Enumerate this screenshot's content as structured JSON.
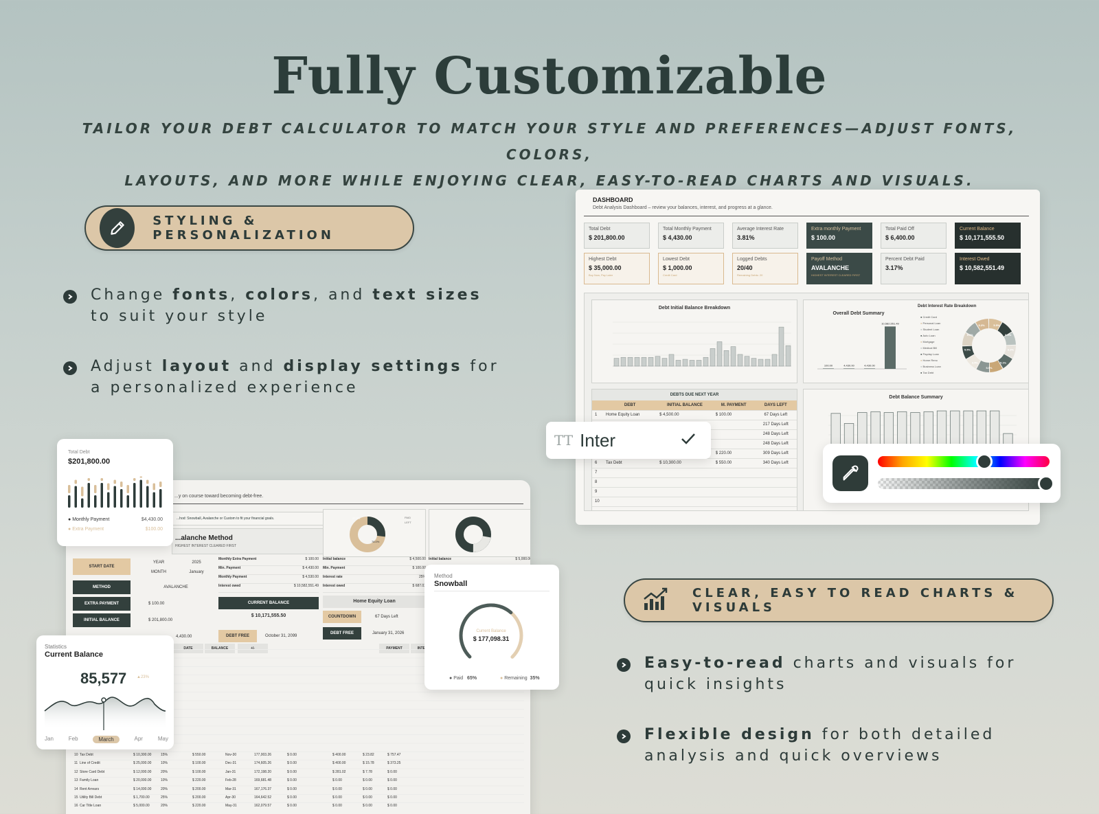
{
  "header": {
    "title": "Fully Customizable",
    "subtitle_line1": "TAILOR YOUR DEBT CALCULATOR TO MATCH YOUR STYLE AND PREFERENCES—ADJUST FONTS, COLORS,",
    "subtitle_line2": "LAYOUTS, AND MORE WHILE ENJOYING CLEAR, EASY-TO-READ CHARTS AND VISUALS."
  },
  "styling": {
    "pill_label": "STYLING & PERSONALIZATION",
    "icon": "pencil-icon",
    "bullets": [
      {
        "pre": "Change ",
        "b1": "fonts",
        "m1": ", ",
        "b2": "colors",
        "m2": ", and ",
        "b3": "text sizes",
        "post": " to suit your style"
      },
      {
        "pre": "Adjust ",
        "b1": "layout",
        "m1": " and ",
        "b2": "display settings",
        "post": " for a personalized experience"
      }
    ]
  },
  "charts_section": {
    "pill_label": "CLEAR, EASY TO READ CHARTS & VISUALS",
    "icon": "bar-chart-icon",
    "bullets": [
      {
        "b1": "Easy-to-read",
        "post": " charts and visuals for quick insights"
      },
      {
        "b1": "Flexible design",
        "post": " for both detailed analysis and quick overviews"
      }
    ]
  },
  "dashboard": {
    "title": "DASHBOARD",
    "subtitle": "Debt Analysis Dashboard – review your balances, interest, and progress at a glance.",
    "kpis_row1": [
      {
        "label": "Total Debt",
        "value": "$ 201,800.00"
      },
      {
        "label": "Total Monthly Payment",
        "value": "$ 4,430.00"
      },
      {
        "label": "Average Interest Rate",
        "value": "3.81%"
      },
      {
        "label": "Extra monthly Payment",
        "value": "$ 100.00"
      },
      {
        "label": "Total Paid Off",
        "value": "$ 6,400.00"
      },
      {
        "label": "Current Balance",
        "value": "$ 10,171,555.50"
      }
    ],
    "kpis_row2": [
      {
        "label": "Highest Debt",
        "value": "$ 35,000.00",
        "note": "Buy Now, Pay Later"
      },
      {
        "label": "Lowest Debt",
        "value": "$ 1,000.00",
        "note": "Credit Card"
      },
      {
        "label": "Logged Debts",
        "value": "20/40",
        "note": "Remaining Debts: 20"
      },
      {
        "label": "Payoff Method",
        "value": "AVALANCHE",
        "note": "HIGHEST INTEREST CLEARED FIRST"
      },
      {
        "label": "Percent Debt Paid",
        "value": "3.17%"
      },
      {
        "label": "Interest Owed",
        "value": "$ 10,582,551.49"
      }
    ],
    "panel_breakdown": "Debt Initial Balance Breakdown",
    "panel_overall": "Overall Debt Summary",
    "panel_interest": "Debt Interest Rate Breakdown",
    "panel_due": "DEBTS DUE NEXT YEAR",
    "panel_balance": "Debt Balance Summary",
    "due_headers": [
      "DEBT",
      "INITIAL BALANCE",
      "M. PAYMENT",
      "DAYS LEFT"
    ],
    "due_rows": [
      {
        "n": "1",
        "debt": "Home Equity Loan",
        "bal": "$ 4,500.00",
        "pay": "$ 100.00",
        "days": "67 Days Left"
      },
      {
        "n": "2",
        "debt": "",
        "bal": "",
        "pay": "",
        "days": "217 Days Left"
      },
      {
        "n": "3",
        "debt": "",
        "bal": "",
        "pay": "",
        "days": "248 Days Left"
      },
      {
        "n": "4",
        "debt": "",
        "bal": "",
        "pay": "",
        "days": "248 Days Left"
      },
      {
        "n": "5",
        "debt": "Student Loan",
        "bal": "",
        "pay": "$ 220.00",
        "days": "309 Days Left"
      },
      {
        "n": "6",
        "debt": "Tax Debt",
        "bal": "$ 10,300.00",
        "pay": "$ 550.00",
        "days": "340 Days Left"
      },
      {
        "n": "7",
        "debt": "",
        "bal": "",
        "pay": "",
        "days": ""
      },
      {
        "n": "8",
        "debt": "",
        "bal": "",
        "pay": "",
        "days": ""
      },
      {
        "n": "9",
        "debt": "",
        "bal": "",
        "pay": "",
        "days": ""
      },
      {
        "n": "10",
        "debt": "",
        "bal": "",
        "pay": "",
        "days": ""
      }
    ],
    "overall_labels": [
      "100.00",
      "4,430.00",
      "4,430.00",
      "10,582,551.49"
    ],
    "overall_cats": [
      "Monthly Extra Payment",
      "Min. Payment",
      "Monthly Payment",
      "Interest owed"
    ],
    "donut_pcts": [
      "5.5%",
      "6.0%",
      "6.3%",
      "5.1%",
      "5.5%",
      "3.5%",
      "5.5%",
      "5.0%",
      "5.3%"
    ],
    "legend": [
      "Credit Card",
      "Personal Loan",
      "Student Loan",
      "Auto Loan",
      "Mortgage",
      "Medical Bill",
      "Payday Loan",
      "Home Reno",
      "Business Loan",
      "Tax Debt"
    ]
  },
  "font_picker": {
    "icon": "text-size-icon",
    "font": "Inter",
    "check": "check-icon"
  },
  "color_picker": {
    "icon": "eyedropper-icon",
    "hue_value": 0.62,
    "alpha_value": 0.98
  },
  "tracker": {
    "intro": "...y on course toward becoming debt-free.",
    "method_hint": "...hod: Snowball, Avalanche or Custom to fit your financial goals.",
    "method_title": "...alanche Method",
    "method_sub": "HIGHEST INTEREST CLEARED FIRST",
    "start_date": "START DATE",
    "year_lbl": "YEAR",
    "year_val": "2025",
    "month_lbl": "MONTH",
    "month_val": "January",
    "method_lbl": "METHOD",
    "method_val": "AVALANCHE",
    "extra_lbl": "EXTRA PAYMENT",
    "extra_val": "$ 100.00",
    "initial_lbl": "INITIAL BALANCE",
    "initial_val": "$ 201,800.00",
    "min_val": "4,430.00",
    "sum_rows": [
      {
        "k": "Monthly Extra Payment",
        "v": "$ 100.00"
      },
      {
        "k": "Min. Payment",
        "v": "$ 4,430.00"
      },
      {
        "k": "Monthly Payment",
        "v": "$ 4,530.00"
      },
      {
        "k": "Interest owed",
        "v": "$ 10,582,551.49"
      }
    ],
    "current_balance_lbl": "CURRENT BALANCE",
    "current_balance_val": "$ 10,171,555.50",
    "debt_free_lbl": "DEBT FREE",
    "debt_free_val": "October 31, 2099",
    "loan_title": "Home Equity Loan",
    "loan_rows": [
      {
        "k": "Initial balance",
        "v": "$ 4,500.00"
      },
      {
        "k": "Min. Payment",
        "v": "$ 100.00"
      },
      {
        "k": "Interest rate",
        "v": "25%"
      },
      {
        "k": "Interest owed",
        "v": "$ 687.02"
      }
    ],
    "loan2_rows": [
      {
        "k": "Initial balance",
        "v": "$ 5,000.00"
      }
    ],
    "countdown_lbl": "COUNTDOWN",
    "countdown_val": "67 Days Left",
    "loan_debt_free_lbl": "DEBT FREE",
    "loan_debt_free_val": "January 31, 2026",
    "donut1_a": "27.2%",
    "donut1_b": "78.0%",
    "legend_paid": "PAID",
    "legend_left": "LEFT",
    "table_headers": [
      "DATE",
      "BALANCE",
      "+/-",
      "PAYMENT",
      "INTEREST",
      "BALANCE",
      "PAID"
    ],
    "left_headers": [
      "REST",
      "MIN. PAYMENT"
    ],
    "bottom_rows": [
      {
        "n": "10",
        "name": "Tax Debt",
        "bal": "$ 10,300.00",
        "rate": "15%",
        "pay": "$ 550.00",
        "date": "Nov-30",
        "b2": "177,003.26",
        "pm": "$ 0.00",
        "p": "$ 400.00",
        "i": "$ 23.82",
        "bb": "$ 757.47"
      },
      {
        "n": "11",
        "name": "Line of Credit",
        "bal": "$ 25,000.00",
        "rate": "10%",
        "pay": "$ 100.00",
        "date": "Dec-31",
        "b2": "174,605.26",
        "pm": "$ 0.00",
        "p": "$ 400.00",
        "i": "$ 15.78",
        "bb": "$ 373.25"
      },
      {
        "n": "12",
        "name": "Store Card Debt",
        "bal": "$ 12,000.00",
        "rate": "20%",
        "pay": "$ 100.00",
        "date": "Jan-31",
        "b2": "172,198.20",
        "pm": "$ 0.00",
        "p": "$ 281.02",
        "i": "$ 7.78",
        "bb": "$ 0.00"
      },
      {
        "n": "13",
        "name": "Family Loan",
        "bal": "$ 20,000.00",
        "rate": "10%",
        "pay": "$ 220.00",
        "date": "Feb-28",
        "b2": "169,681.48",
        "pm": "$ 0.00",
        "p": "$ 0.00",
        "i": "$ 0.00",
        "bb": "$ 0.00"
      },
      {
        "n": "14",
        "name": "Rent Arrears",
        "bal": "$ 14,000.00",
        "rate": "20%",
        "pay": "$ 200.00",
        "date": "Mar-31",
        "b2": "167,176.37",
        "pm": "$ 0.00",
        "p": "$ 0.00",
        "i": "$ 0.00",
        "bb": "$ 0.00"
      },
      {
        "n": "15",
        "name": "Utility Bill Debt",
        "bal": "$ 1,700.00",
        "rate": "25%",
        "pay": "$ 200.00",
        "date": "Apr-30",
        "b2": "164,642.52",
        "pm": "$ 0.00",
        "p": "$ 0.00",
        "i": "$ 0.00",
        "bb": "$ 0.00"
      },
      {
        "n": "16",
        "name": "Car Title Loan",
        "bal": "$ 5,000.00",
        "rate": "20%",
        "pay": "$ 220.00",
        "date": "May-31",
        "b2": "162,079.57",
        "pm": "$ 0.00",
        "p": "$ 0.00",
        "i": "$ 0.00",
        "bb": "$ 0.00"
      }
    ]
  },
  "card_total_debt": {
    "label": "Total Debt",
    "value": "$201,800.00",
    "leg1": "Monthly Payment",
    "leg1v": "$4,430.00",
    "leg2": "Extra Payment",
    "leg2v": "$100.00"
  },
  "card_balance": {
    "small": "Statistics",
    "title": "Current Balance",
    "value": "85,577",
    "delta": "23%",
    "months": [
      "Jan",
      "Feb",
      "March",
      "Apr",
      "May"
    ]
  },
  "card_method": {
    "small": "Method",
    "title": "Snowball",
    "center_small": "Current Balance",
    "center_val": "$ 177,098.31",
    "paid": "Paid",
    "paid_v": "65%",
    "rem": "Remaining",
    "rem_v": "35%"
  },
  "chart_data": [
    {
      "type": "bar",
      "title": "Debt Initial Balance Breakdown",
      "values": [
        8,
        9,
        9,
        9,
        9,
        9,
        10,
        8,
        12,
        6,
        7,
        6,
        6,
        9,
        18,
        25,
        16,
        20,
        12,
        10,
        8,
        7,
        7,
        12,
        40,
        21
      ]
    },
    {
      "type": "bar",
      "title": "Overall Debt Summary",
      "categories": [
        "Monthly Extra Payment",
        "Min. Payment",
        "Monthly Payment",
        "Interest owed"
      ],
      "values": [
        100,
        4430,
        4430,
        10582551.49
      ]
    },
    {
      "type": "bar",
      "title": "Debt Balance Summary",
      "values": [
        37,
        25,
        38,
        39,
        38,
        39,
        38,
        39,
        40,
        40,
        40,
        40,
        40,
        13
      ]
    },
    {
      "type": "bar",
      "title": "Total Debt",
      "values": [
        4,
        7,
        3,
        8,
        4,
        8,
        5,
        7,
        6,
        4,
        8,
        9,
        7,
        5,
        6
      ]
    }
  ],
  "colors": {
    "dark": "#33403d",
    "tan": "#d9bf9a",
    "bg": "#c4cfcc"
  }
}
